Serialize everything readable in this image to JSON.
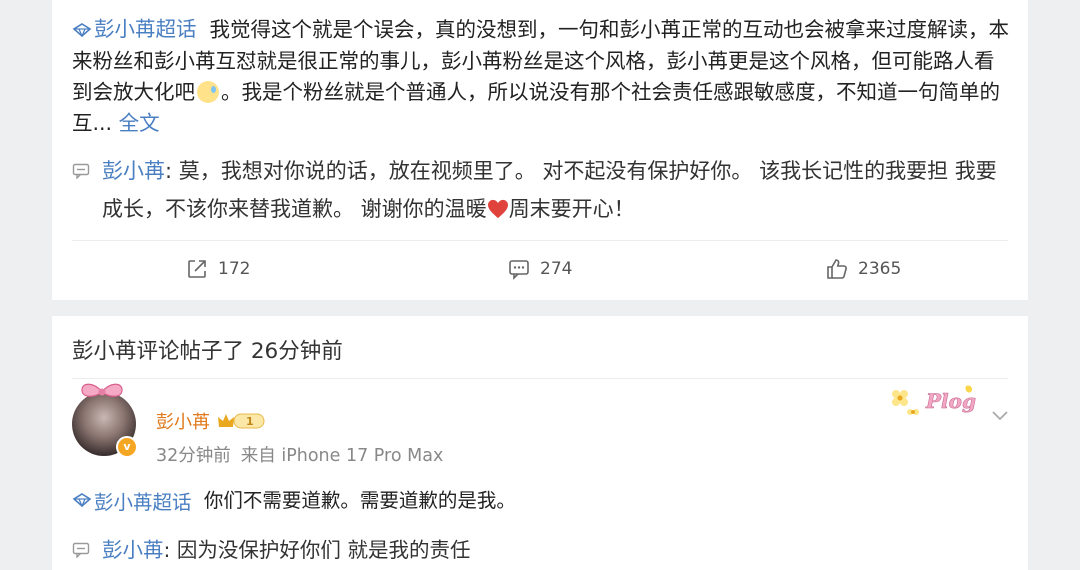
{
  "post": {
    "topic": "彭小苒超话",
    "text_part1": "我觉得这个就是个误会，真的没想到，一句和彭小苒正常的互动也会被拿来过度解读，本来粉丝和彭小苒互怼就是很正常的事儿，彭小苒粉丝是这个风格，彭小苒更是这个风格，但可能路人看到会放大化吧",
    "text_part2": "。我是个粉丝就是个普通人，所以说没有那个社会责任感跟敏感度，不知道一句简单的互...",
    "full_text_link": "全文",
    "quote_name": "彭小苒",
    "quote_text_part1": ": 莫，我想对你说的话，放在视频里了。 对不起没有保护好你。 该我长记性的我要担 我要成长，不该你来替我道歉。 谢谢你的温暖",
    "quote_text_part2": "周末要开心！",
    "actions": {
      "repost_count": "172",
      "comment_count": "274",
      "like_count": "2365"
    }
  },
  "comment_section": {
    "title": "彭小苒评论帖子了 26分钟前",
    "user": {
      "name": "彭小苒",
      "level": "1",
      "time": "32分钟前",
      "source": "来自 iPhone 17 Pro Max",
      "verified_mark": "v"
    },
    "sticker_text": "Plog",
    "reply": {
      "topic": "彭小苒超话",
      "text": "你们不需要道歉。需要道歉的是我。",
      "quote_name": "彭小苒",
      "quote_text": ": 因为没保护好你们 就是我的责任"
    }
  },
  "colors": {
    "link": "#4a7fc1",
    "username": "#e07a1c",
    "heart": "#e0433c",
    "background": "#eeeff1"
  }
}
